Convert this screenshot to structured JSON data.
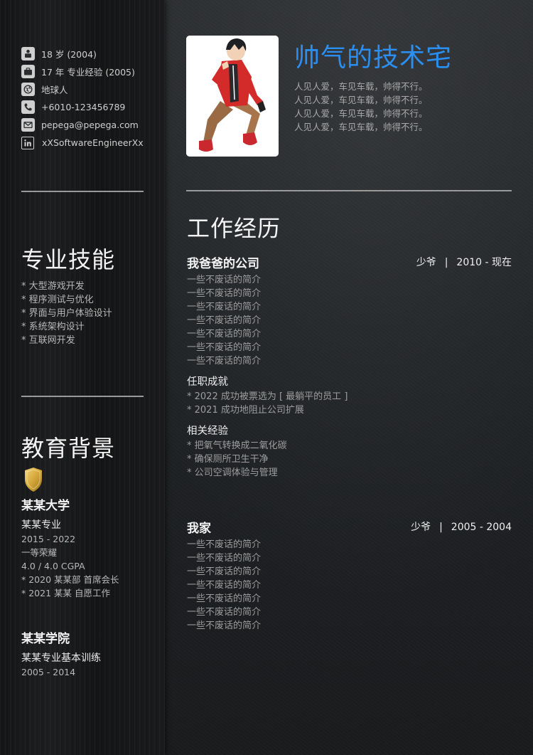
{
  "contact": {
    "age": "18 岁 (2004)",
    "experience": "17 年 专业经验 (2005)",
    "location": "地球人",
    "phone": "+6010-123456789",
    "email": "pepega@pepega.com",
    "linkedin": "xXSoftwareEngineerXx",
    "icons": [
      "person-icon",
      "briefcase-icon",
      "globe-icon",
      "phone-icon",
      "mail-icon",
      "linkedin-icon"
    ]
  },
  "skills": {
    "heading": "专业技能",
    "items": [
      "* 大型游戏开发",
      "* 程序测试与优化",
      "* 界面与用户体验设计",
      "* 系统架构设计",
      "* 互联网开发"
    ]
  },
  "education": {
    "heading": "教育背景",
    "schools": [
      {
        "name": "某某大学",
        "major": "某某专业",
        "lines": [
          "2015 - 2022",
          "一等荣耀",
          "4.0 / 4.0 CGPA",
          "* 2020 某某部 首席会长",
          "* 2021 某某 自愿工作"
        ]
      },
      {
        "name": "某某学院",
        "major": "某某专业基本训练",
        "lines": [
          "2005 - 2014"
        ]
      }
    ]
  },
  "profile": {
    "title": "帅气的技术宅",
    "motto": [
      "人见人爱，车见车载，帅得不行。",
      "人见人爱，车见车载，帅得不行。",
      "人见人爱，车见车载，帅得不行。",
      "人见人爱，车见车载，帅得不行。"
    ]
  },
  "work": {
    "heading": "工作经历",
    "jobs": [
      {
        "company": "我爸爸的公司",
        "role": "少爷",
        "separator": "|",
        "period": "2010 - 现在",
        "desc": [
          "一些不废话的简介",
          "一些不废话的简介",
          "一些不废话的简介",
          "一些不废话的简介",
          "一些不废话的简介",
          "一些不废话的简介",
          "一些不废话的简介"
        ],
        "achievements_heading": "任职成就",
        "achievements": [
          "* 2022 成功被票选为 [ 最躺平的员工 ]",
          "* 2021 成功地阻止公司扩展"
        ],
        "experience_heading": "相关经验",
        "experience": [
          "* 把氧气转换成二氧化碳",
          "* 确保厕所卫生干净",
          "* 公司空调体验与管理"
        ]
      },
      {
        "company": "我家",
        "role": "少爷",
        "separator": "|",
        "period": "2005 - 2004",
        "desc": [
          "一些不废话的简介",
          "一些不废话的简介",
          "一些不废话的简介",
          "一些不废话的简介",
          "一些不废话的简介",
          "一些不废话的简介",
          "一些不废话的简介"
        ]
      }
    ]
  },
  "colors": {
    "accent": "#2a8ff0",
    "badge": "#d4a73a"
  }
}
